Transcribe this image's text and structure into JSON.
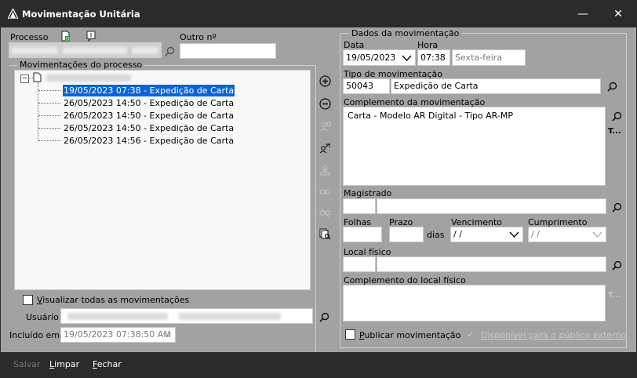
{
  "window": {
    "title": "Movimentação Unitária",
    "minimize_glyph": "—",
    "close_glyph": "✕"
  },
  "left": {
    "processo_label": "Processo",
    "outro_label": "Outro nº",
    "outro_value": "",
    "movimentacoes_label": "Movimentações do processo",
    "tree_items": [
      "19/05/2023 07:38 - Expedição de Carta",
      "26/05/2023 14:50 - Expedição de Carta",
      "26/05/2023 14:50 - Expedição de Carta",
      "26/05/2023 14:50 - Expedição de Carta",
      "26/05/2023 14:56 - Expedição de Carta"
    ],
    "tree_expander": "−",
    "visualizar_label": "Visualizar todas as movimentações",
    "visualizar_hotkey": "V",
    "visualizar_rest": "isualizar todas as movimentações",
    "usuario_label": "Usuário",
    "incluido_label": "Incluído em :",
    "incluido_value": "19/05/2023 07:38:50 AM"
  },
  "right": {
    "group_title": "Dados da movimentação",
    "data_label": "Data",
    "data_value": "19/05/2023",
    "hora_label": "Hora",
    "hora_value": "07:38",
    "weekday_value": "Sexta-feira",
    "tipo_label": "Tipo de movimentação",
    "tipo_code": "50043",
    "tipo_desc": "Expedição de Carta",
    "complemento_label": "Complemento da movimentação",
    "complemento_value": "Carta - Modelo AR Digital - Tipo AR-MP",
    "complemento_extra": "T...",
    "magistrado_label": "Magistrado",
    "folhas_label": "Folhas",
    "prazo_label": "Prazo",
    "dias_label": "dias",
    "vencimento_label": "Vencimento",
    "vencimento_value": " / /",
    "cumprimento_label": "Cumprimento",
    "cumprimento_value": " / /",
    "local_label": "Local físico",
    "comp_local_label": "Complemento do local físico",
    "comp_local_extra": "T...",
    "publicar_hotkey": "P",
    "publicar_rest": "ublicar movimentação",
    "disponivel_label": "Disponível para o público externo"
  },
  "footer": {
    "salvar": "Salvar",
    "limpar_hotkey": "L",
    "limpar_rest": "impar",
    "fechar_hotkey": "F",
    "fechar_rest": "echar"
  }
}
